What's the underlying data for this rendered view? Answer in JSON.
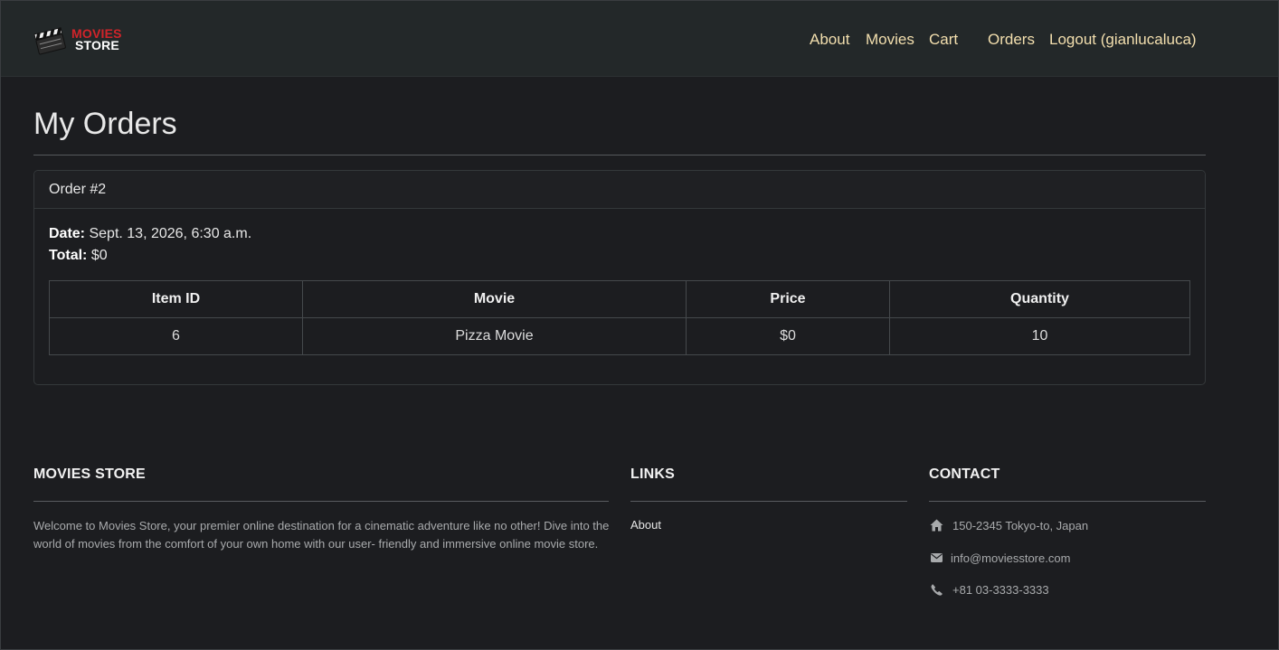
{
  "brand": {
    "line1": "MOVIES",
    "line2": "STORE"
  },
  "nav": {
    "about": "About",
    "movies": "Movies",
    "cart": "Cart",
    "orders": "Orders",
    "logout": "Logout (gianlucaluca)"
  },
  "page_title": "My Orders",
  "order": {
    "header": "Order #2",
    "date_label": "Date:",
    "date_value": "Sept. 13, 2026, 6:30 a.m.",
    "total_label": "Total:",
    "total_value": "$0",
    "columns": [
      "Item ID",
      "Movie",
      "Price",
      "Quantity"
    ],
    "rows": [
      {
        "item_id": "6",
        "movie": "Pizza Movie",
        "price": "$0",
        "quantity": "10"
      }
    ]
  },
  "footer": {
    "about_title": "MOVIES STORE",
    "about_text": "Welcome to Movies Store, your premier online destination for a cinematic adventure like no other! Dive into the world of movies from the comfort of your own home with our user- friendly and immersive online movie store.",
    "links_title": "LINKS",
    "links": [
      "About"
    ],
    "contact_title": "CONTACT",
    "contact": {
      "address": "150-2345 Tokyo-to, Japan",
      "email": "info@moviesstore.com",
      "phone": "+81 03-3333-3333"
    }
  },
  "icons": {
    "logo": "clapperboard-icon",
    "address": "home-icon",
    "email": "envelope-icon",
    "phone": "phone-icon"
  },
  "colors": {
    "background": "#1c1d20",
    "navbar": "#232829",
    "nav_link": "#f3dfae",
    "brand_red": "#d0242a"
  }
}
